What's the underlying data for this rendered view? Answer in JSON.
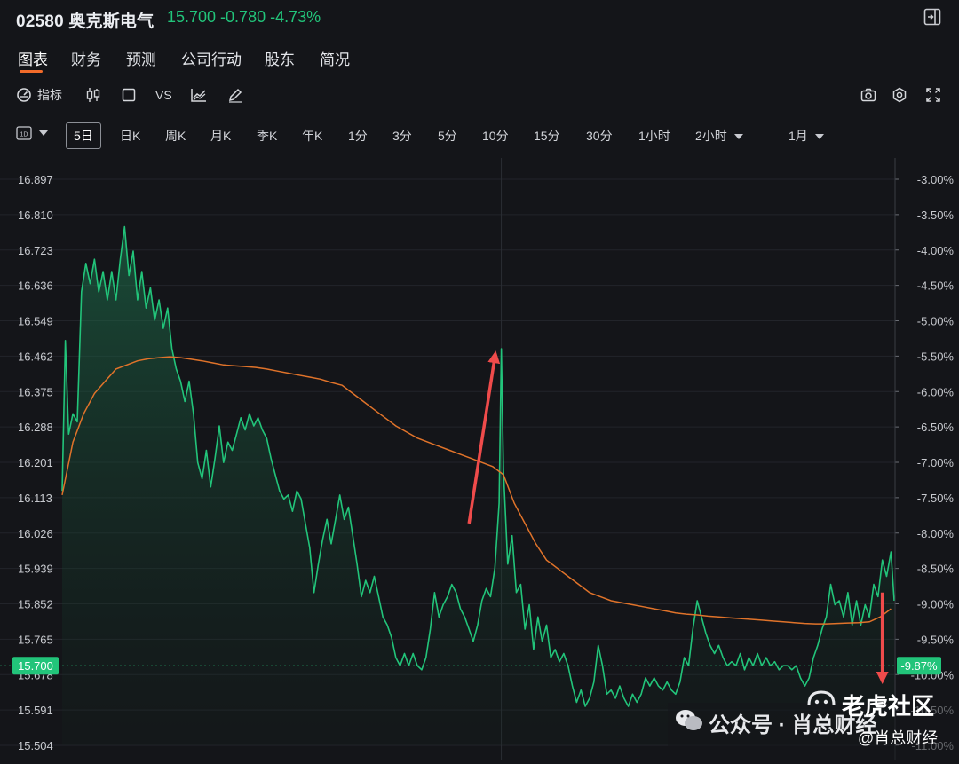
{
  "header": {
    "title": "02580 奥克斯电气",
    "price_line": "15.700  -0.780  -4.73%",
    "exit_icon": "exit-fullscreen-icon"
  },
  "tabs": [
    {
      "label": "图表",
      "active": true
    },
    {
      "label": "财务"
    },
    {
      "label": "预测"
    },
    {
      "label": "公司行动"
    },
    {
      "label": "股东"
    },
    {
      "label": "简况"
    }
  ],
  "toolbar": {
    "indicator_label": "指标",
    "vs_label": "VS",
    "icons": [
      "gauge-icon",
      "candlestick-icon",
      "square-icon",
      "compare-icon",
      "pencil-icon",
      "camera-icon",
      "gear-icon",
      "expand-icon"
    ]
  },
  "periods": {
    "mini_label": "1D",
    "items": [
      "5日",
      "日K",
      "周K",
      "月K",
      "季K",
      "年K",
      "1分",
      "3分",
      "5分",
      "10分",
      "15分",
      "30分",
      "1小时",
      "2小时",
      "1月"
    ],
    "selected": "5日"
  },
  "watermark": {
    "wechat": "公众号 · 肖总财经",
    "brand": "老虎社区",
    "handle": "@肖总财经"
  },
  "colors": {
    "up_green": "#22c47a",
    "ma_orange": "#e0732a",
    "arrow_red": "#ef4b4b",
    "tab_accent": "#f26b2a"
  },
  "chart_data": {
    "type": "line",
    "left_ticks": [
      "16.897",
      "16.810",
      "16.723",
      "16.636",
      "16.549",
      "16.462",
      "16.375",
      "16.288",
      "16.201",
      "16.113",
      "16.026",
      "15.939",
      "15.852",
      "15.765",
      "15.678",
      "15.591",
      "15.504"
    ],
    "right_ticks": [
      "-3.00%",
      "-3.50%",
      "-4.00%",
      "-4.50%",
      "-5.00%",
      "-5.50%",
      "-6.00%",
      "-6.50%",
      "-7.00%",
      "-7.50%",
      "-8.00%",
      "-8.50%",
      "-9.00%",
      "-9.50%",
      "-10.00%",
      "-10.50%",
      "-11.00%"
    ],
    "ylim": [
      15.504,
      16.897
    ],
    "current_price": {
      "value": 15.7,
      "label": "15.700",
      "pct_label": "-9.87%"
    },
    "price_series": [
      [
        0,
        16.13
      ],
      [
        0.3,
        16.5
      ],
      [
        0.6,
        16.27
      ],
      [
        1.0,
        16.32
      ],
      [
        1.4,
        16.3
      ],
      [
        1.8,
        16.62
      ],
      [
        2.2,
        16.69
      ],
      [
        2.6,
        16.64
      ],
      [
        3.0,
        16.7
      ],
      [
        3.4,
        16.62
      ],
      [
        3.8,
        16.67
      ],
      [
        4.2,
        16.6
      ],
      [
        4.6,
        16.67
      ],
      [
        5.0,
        16.6
      ],
      [
        5.4,
        16.7
      ],
      [
        5.8,
        16.78
      ],
      [
        6.2,
        16.66
      ],
      [
        6.6,
        16.72
      ],
      [
        7.0,
        16.6
      ],
      [
        7.4,
        16.67
      ],
      [
        7.8,
        16.58
      ],
      [
        8.2,
        16.63
      ],
      [
        8.6,
        16.55
      ],
      [
        9.0,
        16.6
      ],
      [
        9.4,
        16.53
      ],
      [
        9.8,
        16.58
      ],
      [
        10.2,
        16.48
      ],
      [
        10.6,
        16.43
      ],
      [
        11.0,
        16.4
      ],
      [
        11.4,
        16.35
      ],
      [
        11.8,
        16.4
      ],
      [
        12.2,
        16.32
      ],
      [
        12.6,
        16.2
      ],
      [
        13.0,
        16.16
      ],
      [
        13.4,
        16.23
      ],
      [
        13.8,
        16.14
      ],
      [
        14.2,
        16.21
      ],
      [
        14.6,
        16.29
      ],
      [
        15.0,
        16.2
      ],
      [
        15.4,
        16.25
      ],
      [
        15.8,
        16.23
      ],
      [
        16.2,
        16.27
      ],
      [
        16.6,
        16.31
      ],
      [
        17.0,
        16.28
      ],
      [
        17.4,
        16.32
      ],
      [
        17.8,
        16.29
      ],
      [
        18.2,
        16.31
      ],
      [
        18.6,
        16.28
      ],
      [
        19.0,
        16.26
      ],
      [
        19.4,
        16.21
      ],
      [
        19.8,
        16.17
      ],
      [
        20.2,
        16.13
      ],
      [
        20.6,
        16.11
      ],
      [
        21.0,
        16.12
      ],
      [
        21.4,
        16.08
      ],
      [
        21.8,
        16.13
      ],
      [
        22.2,
        16.11
      ],
      [
        22.6,
        16.05
      ],
      [
        23.0,
        15.99
      ],
      [
        23.4,
        15.88
      ],
      [
        23.8,
        15.95
      ],
      [
        24.2,
        16.01
      ],
      [
        24.6,
        16.06
      ],
      [
        25.0,
        16.0
      ],
      [
        25.4,
        16.06
      ],
      [
        25.8,
        16.12
      ],
      [
        26.2,
        16.06
      ],
      [
        26.6,
        16.09
      ],
      [
        27.0,
        16.02
      ],
      [
        27.4,
        15.95
      ],
      [
        27.8,
        15.87
      ],
      [
        28.2,
        15.91
      ],
      [
        28.6,
        15.88
      ],
      [
        29.0,
        15.92
      ],
      [
        29.4,
        15.87
      ],
      [
        29.8,
        15.82
      ],
      [
        30.2,
        15.8
      ],
      [
        30.6,
        15.77
      ],
      [
        31.0,
        15.72
      ],
      [
        31.4,
        15.7
      ],
      [
        31.8,
        15.73
      ],
      [
        32.2,
        15.7
      ],
      [
        32.6,
        15.73
      ],
      [
        33.0,
        15.7
      ],
      [
        33.4,
        15.69
      ],
      [
        33.8,
        15.72
      ],
      [
        34.2,
        15.79
      ],
      [
        34.6,
        15.88
      ],
      [
        35.0,
        15.82
      ],
      [
        35.4,
        15.85
      ],
      [
        35.8,
        15.87
      ],
      [
        36.2,
        15.9
      ],
      [
        36.6,
        15.88
      ],
      [
        37.0,
        15.84
      ],
      [
        37.4,
        15.82
      ],
      [
        37.8,
        15.79
      ],
      [
        38.2,
        15.76
      ],
      [
        38.6,
        15.8
      ],
      [
        39.0,
        15.86
      ],
      [
        39.4,
        15.89
      ],
      [
        39.8,
        15.87
      ],
      [
        40.2,
        15.94
      ],
      [
        40.6,
        16.1
      ],
      [
        40.8,
        16.48
      ],
      [
        41.0,
        16.18
      ],
      [
        41.4,
        15.95
      ],
      [
        41.8,
        16.02
      ],
      [
        42.2,
        15.88
      ],
      [
        42.6,
        15.9
      ],
      [
        43.0,
        15.79
      ],
      [
        43.4,
        15.85
      ],
      [
        43.8,
        15.74
      ],
      [
        44.2,
        15.82
      ],
      [
        44.6,
        15.76
      ],
      [
        45.0,
        15.8
      ],
      [
        45.4,
        15.72
      ],
      [
        45.8,
        15.74
      ],
      [
        46.2,
        15.71
      ],
      [
        46.6,
        15.73
      ],
      [
        47.0,
        15.7
      ],
      [
        47.4,
        15.65
      ],
      [
        47.8,
        15.61
      ],
      [
        48.2,
        15.64
      ],
      [
        48.6,
        15.6
      ],
      [
        49.0,
        15.62
      ],
      [
        49.4,
        15.66
      ],
      [
        49.8,
        15.75
      ],
      [
        50.2,
        15.7
      ],
      [
        50.6,
        15.63
      ],
      [
        51.0,
        15.64
      ],
      [
        51.4,
        15.62
      ],
      [
        51.8,
        15.65
      ],
      [
        52.2,
        15.62
      ],
      [
        52.6,
        15.6
      ],
      [
        53.0,
        15.63
      ],
      [
        53.4,
        15.61
      ],
      [
        53.8,
        15.63
      ],
      [
        54.2,
        15.67
      ],
      [
        54.6,
        15.65
      ],
      [
        55.0,
        15.67
      ],
      [
        55.4,
        15.65
      ],
      [
        55.8,
        15.64
      ],
      [
        56.2,
        15.66
      ],
      [
        56.6,
        15.64
      ],
      [
        57.0,
        15.63
      ],
      [
        57.4,
        15.66
      ],
      [
        57.8,
        15.72
      ],
      [
        58.2,
        15.7
      ],
      [
        58.6,
        15.79
      ],
      [
        59.0,
        15.86
      ],
      [
        59.4,
        15.82
      ],
      [
        59.8,
        15.78
      ],
      [
        60.2,
        15.75
      ],
      [
        60.6,
        15.73
      ],
      [
        61.0,
        15.75
      ],
      [
        61.4,
        15.72
      ],
      [
        61.8,
        15.7
      ],
      [
        62.2,
        15.71
      ],
      [
        62.6,
        15.7
      ],
      [
        63.0,
        15.73
      ],
      [
        63.4,
        15.69
      ],
      [
        63.8,
        15.72
      ],
      [
        64.2,
        15.7
      ],
      [
        64.6,
        15.73
      ],
      [
        65.0,
        15.7
      ],
      [
        65.4,
        15.72
      ],
      [
        65.8,
        15.7
      ],
      [
        66.2,
        15.71
      ],
      [
        66.6,
        15.69
      ],
      [
        67.0,
        15.7
      ],
      [
        67.4,
        15.7
      ],
      [
        67.8,
        15.69
      ],
      [
        68.2,
        15.7
      ],
      [
        68.6,
        15.67
      ],
      [
        69.0,
        15.65
      ],
      [
        69.4,
        15.67
      ],
      [
        69.8,
        15.72
      ],
      [
        70.2,
        15.75
      ],
      [
        70.6,
        15.79
      ],
      [
        71.0,
        15.82
      ],
      [
        71.4,
        15.9
      ],
      [
        71.8,
        15.85
      ],
      [
        72.2,
        15.86
      ],
      [
        72.6,
        15.82
      ],
      [
        73.0,
        15.88
      ],
      [
        73.4,
        15.8
      ],
      [
        73.8,
        15.86
      ],
      [
        74.2,
        15.8
      ],
      [
        74.6,
        15.85
      ],
      [
        75.0,
        15.82
      ],
      [
        75.4,
        15.9
      ],
      [
        75.8,
        15.87
      ],
      [
        76.2,
        15.96
      ],
      [
        76.6,
        15.92
      ],
      [
        77.0,
        15.98
      ],
      [
        77.3,
        15.86
      ]
    ],
    "ma_series": [
      [
        0,
        16.12
      ],
      [
        1,
        16.25
      ],
      [
        2,
        16.32
      ],
      [
        3,
        16.37
      ],
      [
        4,
        16.4
      ],
      [
        5,
        16.43
      ],
      [
        6,
        16.44
      ],
      [
        7,
        16.45
      ],
      [
        8,
        16.455
      ],
      [
        9,
        16.458
      ],
      [
        10,
        16.46
      ],
      [
        11,
        16.458
      ],
      [
        12,
        16.454
      ],
      [
        13,
        16.45
      ],
      [
        14,
        16.445
      ],
      [
        15,
        16.44
      ],
      [
        16,
        16.438
      ],
      [
        17,
        16.436
      ],
      [
        18,
        16.434
      ],
      [
        19,
        16.43
      ],
      [
        20,
        16.425
      ],
      [
        21,
        16.42
      ],
      [
        22,
        16.415
      ],
      [
        23,
        16.41
      ],
      [
        24,
        16.405
      ],
      [
        25,
        16.397
      ],
      [
        26,
        16.39
      ],
      [
        27,
        16.37
      ],
      [
        28,
        16.35
      ],
      [
        29,
        16.33
      ],
      [
        30,
        16.31
      ],
      [
        31,
        16.29
      ],
      [
        32,
        16.275
      ],
      [
        33,
        16.26
      ],
      [
        34,
        16.25
      ],
      [
        35,
        16.24
      ],
      [
        36,
        16.23
      ],
      [
        37,
        16.22
      ],
      [
        38,
        16.21
      ],
      [
        39,
        16.2
      ],
      [
        40,
        16.19
      ],
      [
        41,
        16.17
      ],
      [
        42,
        16.1
      ],
      [
        43,
        16.05
      ],
      [
        44,
        16.0
      ],
      [
        45,
        15.96
      ],
      [
        46,
        15.94
      ],
      [
        47,
        15.92
      ],
      [
        48,
        15.9
      ],
      [
        49,
        15.88
      ],
      [
        50,
        15.87
      ],
      [
        51,
        15.86
      ],
      [
        52,
        15.855
      ],
      [
        53,
        15.85
      ],
      [
        54,
        15.845
      ],
      [
        55,
        15.84
      ],
      [
        56,
        15.835
      ],
      [
        57,
        15.83
      ],
      [
        58,
        15.827
      ],
      [
        59,
        15.825
      ],
      [
        60,
        15.822
      ],
      [
        61,
        15.82
      ],
      [
        62,
        15.818
      ],
      [
        63,
        15.816
      ],
      [
        64,
        15.814
      ],
      [
        65,
        15.812
      ],
      [
        66,
        15.81
      ],
      [
        67,
        15.808
      ],
      [
        68,
        15.806
      ],
      [
        69,
        15.804
      ],
      [
        70,
        15.803
      ],
      [
        71,
        15.803
      ],
      [
        72,
        15.804
      ],
      [
        73,
        15.805
      ],
      [
        74,
        15.806
      ],
      [
        75,
        15.808
      ],
      [
        76,
        15.82
      ],
      [
        77,
        15.84
      ]
    ],
    "x_range": [
      0,
      77.3
    ],
    "annotations": [
      {
        "kind": "arrow-up",
        "from": [
          37.8,
          16.05
        ],
        "to": [
          40.2,
          16.46
        ]
      },
      {
        "kind": "arrow-down",
        "from": [
          76.2,
          15.88
        ],
        "to": [
          76.2,
          15.67
        ]
      }
    ]
  }
}
